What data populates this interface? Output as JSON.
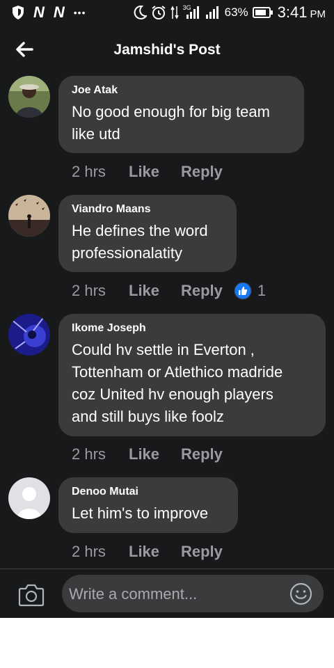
{
  "status_bar": {
    "network_letters": [
      "N",
      "N"
    ],
    "more": "•••",
    "network_type": "3G",
    "battery_percent": "63%",
    "time": "3:41",
    "ampm": "PM"
  },
  "header": {
    "title": "Jamshid's Post",
    "back_icon": "back-arrow-icon"
  },
  "comments": [
    {
      "author": "Joe Atak",
      "text_lines": [
        "No good enough for big team",
        "like utd"
      ],
      "time": "2 hrs",
      "like_label": "Like",
      "reply_label": "Reply"
    },
    {
      "author": "Viandro Maans",
      "text_lines": [
        "He defines the word",
        "professionalatity"
      ],
      "time": "2 hrs",
      "like_label": "Like",
      "reply_label": "Reply",
      "reaction_count": "1"
    },
    {
      "author": "Ikome Joseph",
      "text_lines": [
        "Could hv settle in Everton ,",
        "Tottenham or Atlethico madride",
        "coz United hv enough players",
        "and still buys like foolz"
      ],
      "time": "2 hrs",
      "like_label": "Like",
      "reply_label": "Reply"
    },
    {
      "author": "Denoo Mutai",
      "text_lines": [
        "Let him's to improve"
      ],
      "time": "2 hrs",
      "like_label": "Like",
      "reply_label": "Reply"
    }
  ],
  "composer": {
    "placeholder": "Write a comment...",
    "camera_icon": "camera-icon",
    "emoji_icon": "emoji-icon"
  },
  "colors": {
    "background": "#18191a",
    "bubble": "#3a3b3c",
    "meta_text": "#9a9b9e",
    "like_blue": "#1877f2"
  }
}
